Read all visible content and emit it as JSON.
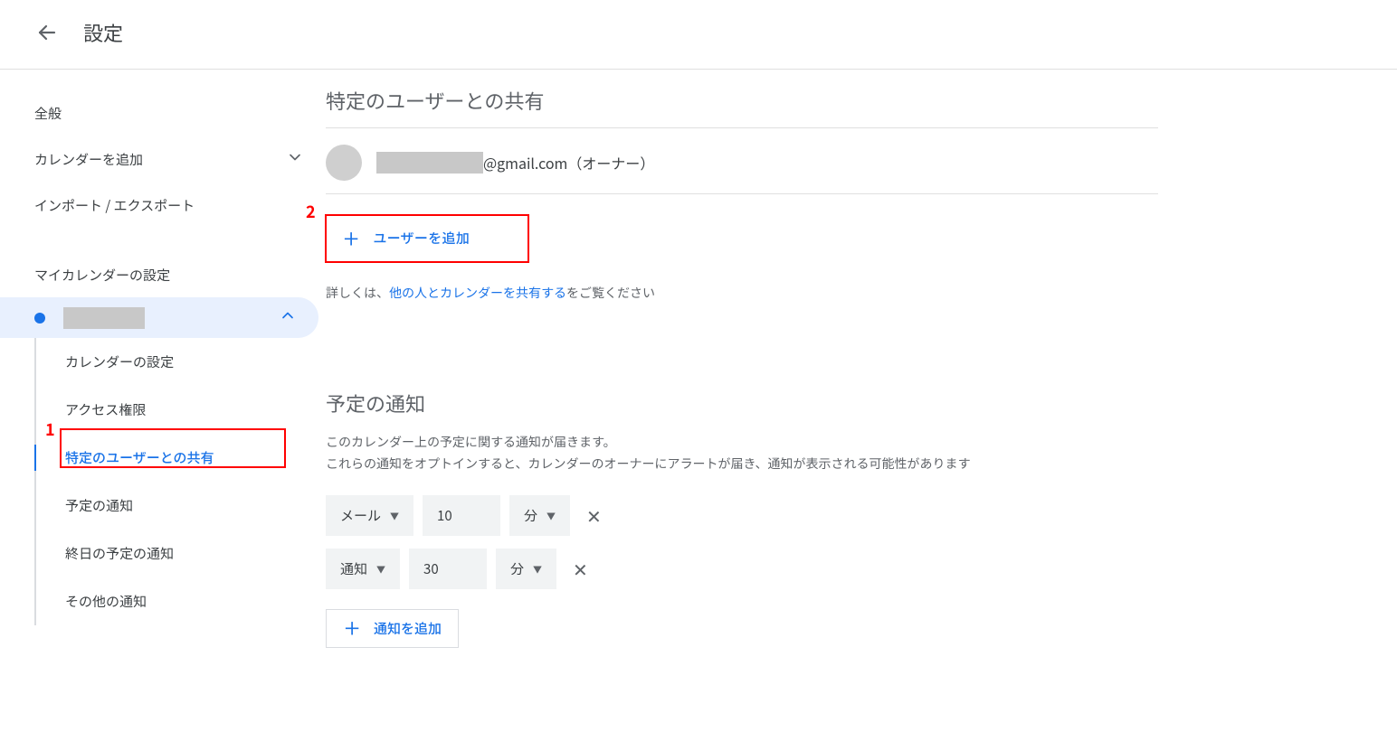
{
  "header": {
    "title": "設定"
  },
  "sidebar": {
    "general": "全般",
    "add_calendar": "カレンダーを追加",
    "import_export": "インポート / エクスポート",
    "my_cal_settings": "マイカレンダーの設定",
    "sub": {
      "cal_settings": "カレンダーの設定",
      "access": "アクセス権限",
      "share_specific": "特定のユーザーとの共有",
      "event_notif": "予定の通知",
      "allday_notif": "終日の予定の通知",
      "other_notif": "その他の通知"
    }
  },
  "share": {
    "title": "特定のユーザーとの共有",
    "email_suffix": "@gmail.com（オーナー）",
    "add_user": "ユーザーを追加",
    "help_prefix": "詳しくは、",
    "help_link": "他の人とカレンダーを共有する",
    "help_suffix": "をご覧ください"
  },
  "notif": {
    "title": "予定の通知",
    "desc1": "このカレンダー上の予定に関する通知が届きます。",
    "desc2": "これらの通知をオプトインすると、カレンダーのオーナーにアラートが届き、通知が表示される可能性があります",
    "rows": [
      {
        "type": "メール",
        "value": "10",
        "unit": "分"
      },
      {
        "type": "通知",
        "value": "30",
        "unit": "分"
      }
    ],
    "add_notif": "通知を追加"
  },
  "annotations": {
    "one": "1",
    "two": "2"
  }
}
